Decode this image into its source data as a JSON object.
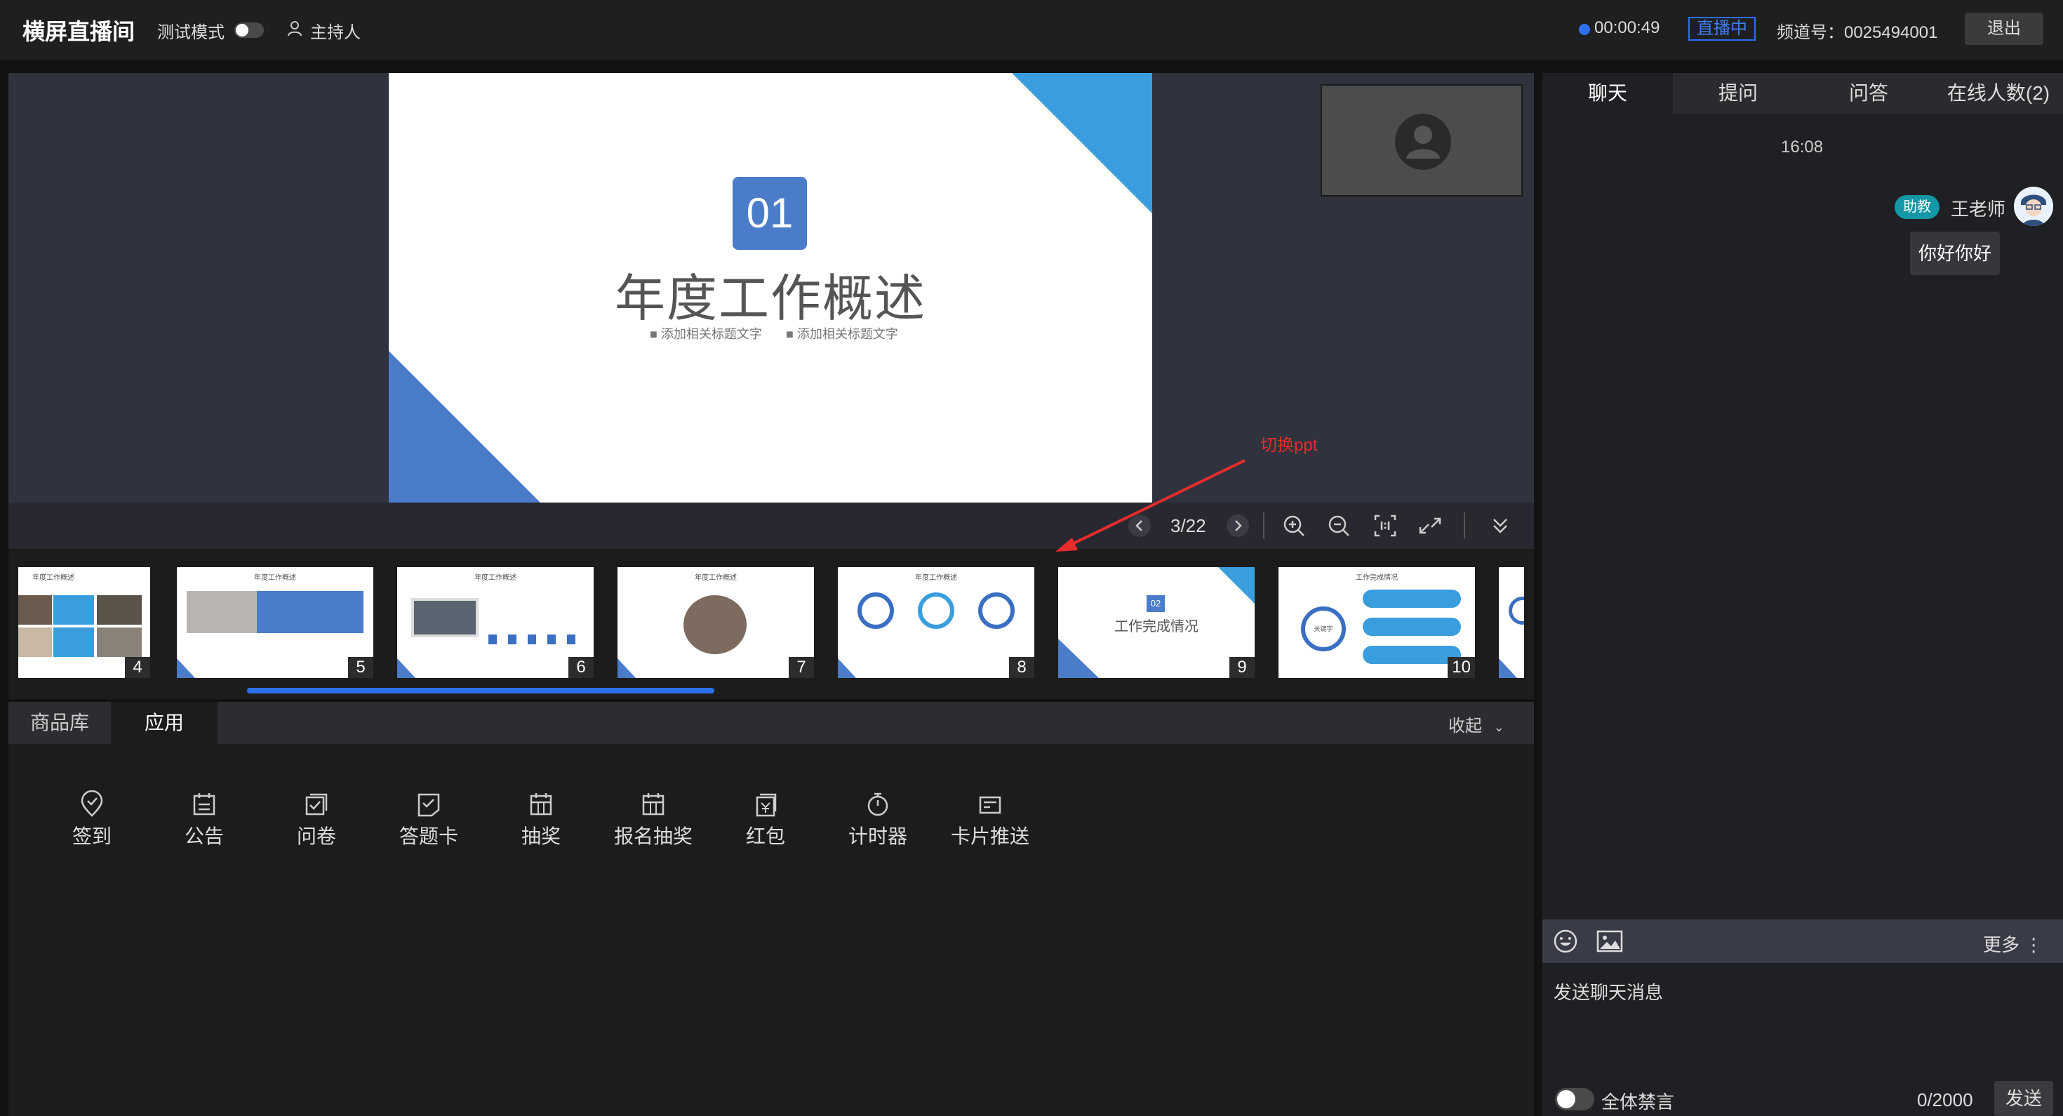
{
  "topbar": {
    "title": "横屏直播间",
    "test_mode_label": "测试模式",
    "role_label": "主持人",
    "timer": "00:00:49",
    "live_status": "直播中",
    "channel": "频道号：0025494001",
    "exit_label": "退出"
  },
  "slide": {
    "badge": "01",
    "title": "年度工作概述",
    "subtitle_left": "■ 添加相关标题文字",
    "subtitle_right": "■ 添加相关标题文字"
  },
  "annotation": "切换ppt",
  "controls": {
    "page_indicator": "3/22"
  },
  "thumbnails": [
    {
      "num": "4",
      "title": "年度工作概述"
    },
    {
      "num": "5",
      "title": "年度工作概述"
    },
    {
      "num": "6",
      "title": "年度工作概述"
    },
    {
      "num": "7",
      "title": "年度工作概述"
    },
    {
      "num": "8",
      "title": "年度工作概述"
    },
    {
      "num": "9",
      "title": "工作完成情况",
      "badge": "02"
    },
    {
      "num": "10",
      "title": "工作完成情况",
      "center": "关键字"
    }
  ],
  "panel": {
    "tab_goods": "商品库",
    "tab_apps": "应用",
    "collapse_label": "收起"
  },
  "apps": [
    {
      "label": "签到",
      "icon": "check-in-icon"
    },
    {
      "label": "公告",
      "icon": "announcement-icon"
    },
    {
      "label": "问卷",
      "icon": "questionnaire-icon"
    },
    {
      "label": "答题卡",
      "icon": "answer-card-icon"
    },
    {
      "label": "抽奖",
      "icon": "lottery-icon"
    },
    {
      "label": "报名抽奖",
      "icon": "signup-lottery-icon"
    },
    {
      "label": "红包",
      "icon": "red-packet-icon"
    },
    {
      "label": "计时器",
      "icon": "timer-icon"
    },
    {
      "label": "卡片推送",
      "icon": "card-push-icon"
    }
  ],
  "chat": {
    "tabs": [
      "聊天",
      "提问",
      "问答",
      "在线人数(2)"
    ],
    "time": "16:08",
    "sender_badge": "助教",
    "sender_name": "王老师",
    "message": "你好你好",
    "more_label": "更多",
    "input_placeholder": "发送聊天消息",
    "mute_label": "全体禁言",
    "char_count": "0/2000",
    "send_label": "发送"
  },
  "colors": {
    "accent_blue": "#2f6ff2",
    "slide_blue": "#4a7cc9",
    "slide_light_blue": "#3a9ede",
    "annotation_red": "#e62c2c",
    "badge_teal": "#1497a6"
  }
}
